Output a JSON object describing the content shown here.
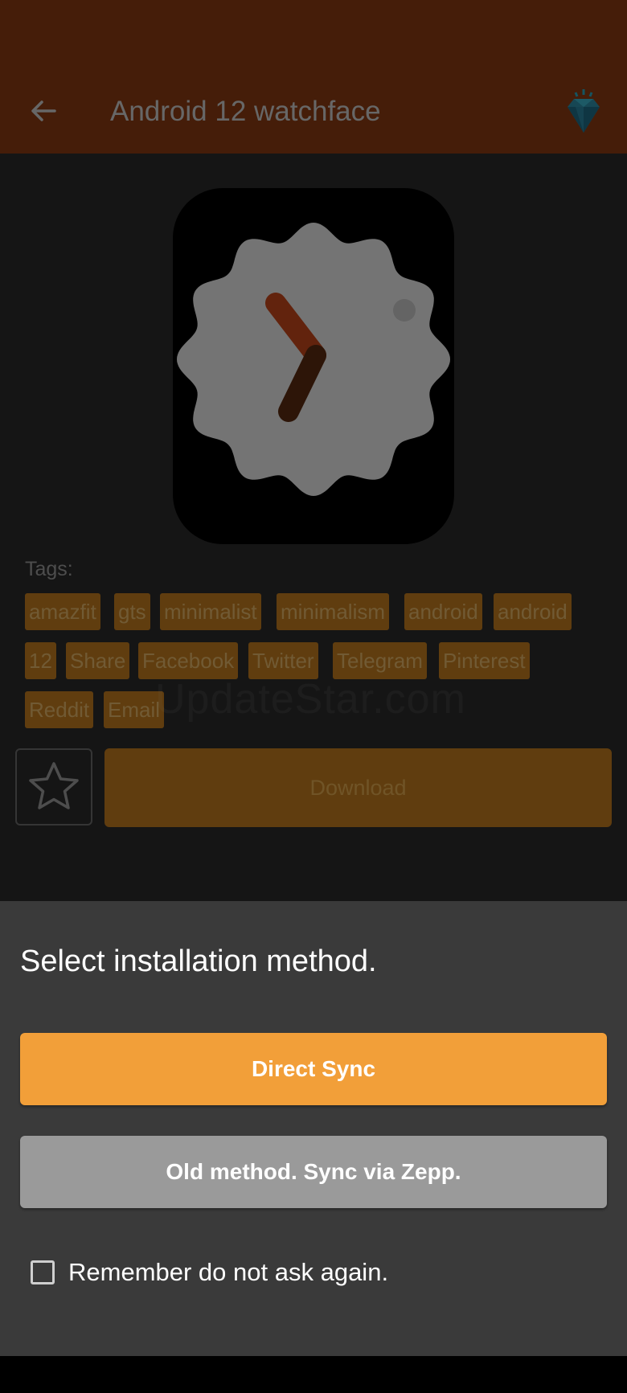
{
  "header": {
    "title": "Android 12 watchface",
    "back_icon": "arrow-left-icon",
    "premium_icon": "diamond-icon"
  },
  "watch_preview": {
    "icon": "wavy-clock-face-icon"
  },
  "tags": {
    "label": "Tags:",
    "items": [
      "amazfit",
      "gts",
      "minimalist",
      "minimalism",
      "android",
      "android",
      "12",
      "Share",
      "Facebook",
      "Twitter",
      "Telegram",
      "Pinterest",
      "Reddit",
      "Email"
    ]
  },
  "watermark": "UpdateStar.com",
  "actions": {
    "favorite_icon": "star-outline-icon",
    "download_label": "Download"
  },
  "sheet": {
    "title": "Select installation method.",
    "direct_sync_label": "Direct Sync",
    "old_method_label": "Old method. Sync via Zepp.",
    "remember_label": "Remember do not ask again.",
    "remember_checked": false
  },
  "colors": {
    "appbar": "#8a3a12",
    "accent": "#f29f39",
    "tag_bg": "#c17b1e",
    "secondary_button": "#9a9a9a"
  }
}
